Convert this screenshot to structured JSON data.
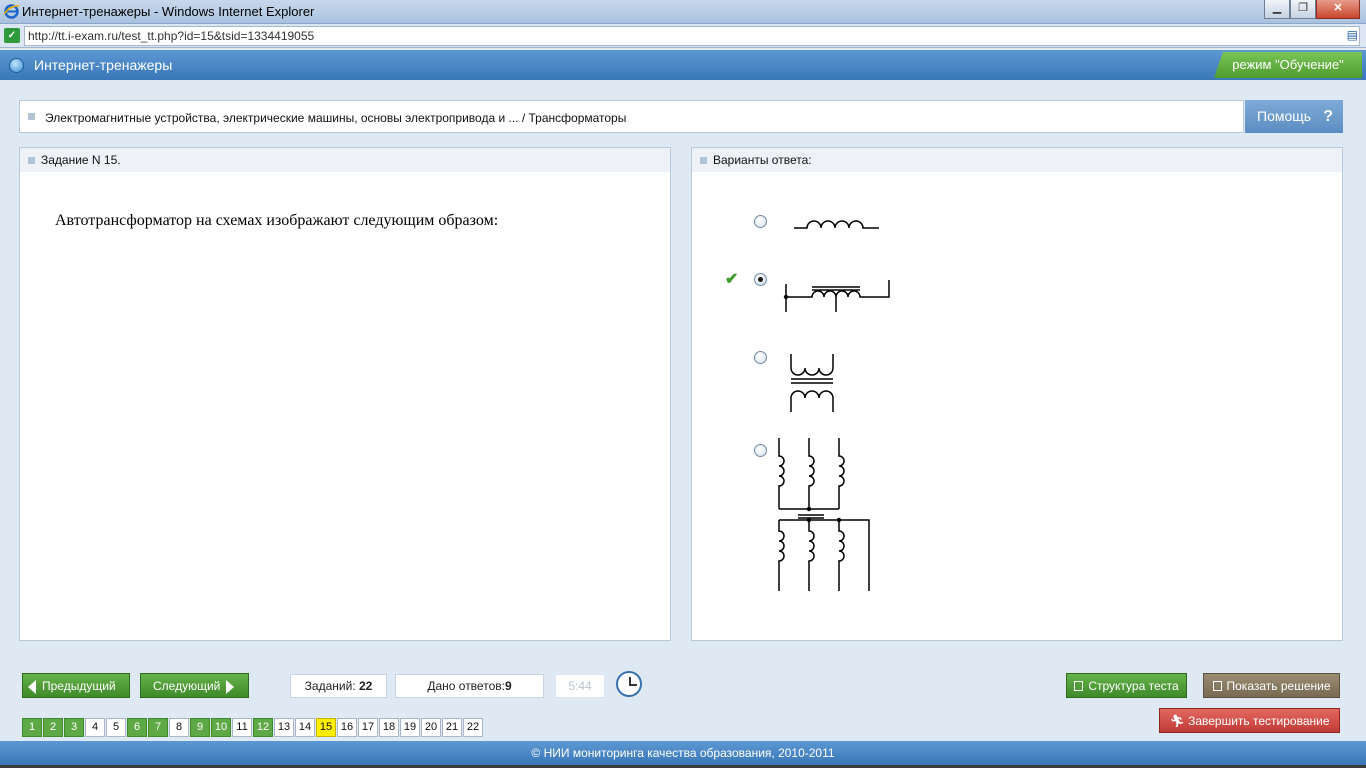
{
  "window": {
    "title": "Интернет-тренажеры - Windows Internet Explorer",
    "url": "http://tt.i-exam.ru/test_tt.php?id=15&tsid=1334419055"
  },
  "app": {
    "title": "Интернет-тренажеры",
    "mode": "режим \"Обучение\""
  },
  "breadcrumb": "Электромагнитные устройства, электрические машины, основы электропривода и ... / Трансформаторы",
  "help_label": "Помощь",
  "task": {
    "header": "Задание N 15.",
    "question": "Автотрансформатор на схемах изображают следующим образом:"
  },
  "answers": {
    "header": "Варианты ответа:",
    "options": [
      {
        "icon": "inductor-symbol",
        "selected": false
      },
      {
        "icon": "autotransformer-symbol",
        "selected": true
      },
      {
        "icon": "transformer-symbol",
        "selected": false
      },
      {
        "icon": "three-phase-transformer-symbol",
        "selected": false
      }
    ]
  },
  "nav": {
    "prev_label": "Предыдущий",
    "next_label": "Следующий",
    "tasks_label": "Заданий:",
    "tasks_count": "22",
    "answers_label": "Дано ответов:",
    "answers_count": "9",
    "timer": "5:44",
    "structure_label": "Структура теста",
    "show_solution_label": "Показать решение",
    "finish_label": "Завершить тестирование",
    "pages": [
      {
        "n": "1",
        "state": "done"
      },
      {
        "n": "2",
        "state": "done"
      },
      {
        "n": "3",
        "state": "done"
      },
      {
        "n": "4",
        "state": "todo"
      },
      {
        "n": "5",
        "state": "todo"
      },
      {
        "n": "6",
        "state": "done"
      },
      {
        "n": "7",
        "state": "done"
      },
      {
        "n": "8",
        "state": "todo"
      },
      {
        "n": "9",
        "state": "done"
      },
      {
        "n": "10",
        "state": "done"
      },
      {
        "n": "11",
        "state": "todo"
      },
      {
        "n": "12",
        "state": "done"
      },
      {
        "n": "13",
        "state": "todo"
      },
      {
        "n": "14",
        "state": "todo"
      },
      {
        "n": "15",
        "state": "current"
      },
      {
        "n": "16",
        "state": "todo"
      },
      {
        "n": "17",
        "state": "todo"
      },
      {
        "n": "18",
        "state": "todo"
      },
      {
        "n": "19",
        "state": "todo"
      },
      {
        "n": "20",
        "state": "todo"
      },
      {
        "n": "21",
        "state": "todo"
      },
      {
        "n": "22",
        "state": "todo"
      }
    ]
  },
  "footer": "© НИИ мониторинга качества образования, 2010-2011",
  "colors": {
    "accent_green": "#5ea845",
    "current_page": "#ffee00",
    "header_blue": "#3a77b7",
    "finish_red": "#c13b35"
  }
}
